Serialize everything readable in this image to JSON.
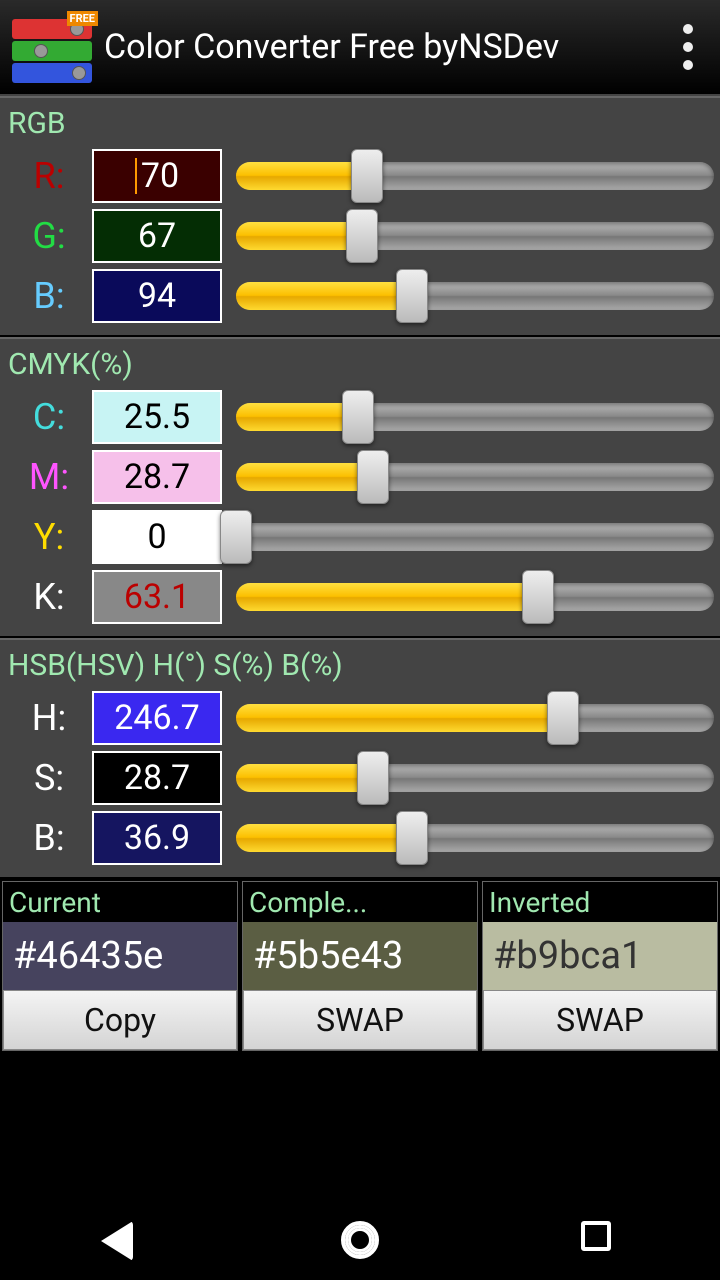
{
  "header": {
    "title": "Color Converter Free byNSDev",
    "free_badge": "FREE"
  },
  "rgb": {
    "label": "RGB",
    "rows": [
      {
        "ch": "R:",
        "val": "70",
        "pct": 27.5
      },
      {
        "ch": "G:",
        "val": "67",
        "pct": 26.3
      },
      {
        "ch": "B:",
        "val": "94",
        "pct": 36.9
      }
    ]
  },
  "cmyk": {
    "label": "CMYK(%)",
    "rows": [
      {
        "ch": "C:",
        "val": "25.5",
        "pct": 25.5
      },
      {
        "ch": "M:",
        "val": "28.7",
        "pct": 28.7
      },
      {
        "ch": "Y:",
        "val": "0",
        "pct": 0
      },
      {
        "ch": "K:",
        "val": "63.1",
        "pct": 63.1
      }
    ]
  },
  "hsb": {
    "label": "HSB(HSV) H(°) S(%) B(%)",
    "rows": [
      {
        "ch": "H:",
        "val": "246.7",
        "pct": 68.5
      },
      {
        "ch": "S:",
        "val": "28.7",
        "pct": 28.7
      },
      {
        "ch": "B:",
        "val": "36.9",
        "pct": 36.9
      }
    ]
  },
  "swatches": {
    "current": {
      "label": "Current",
      "hex": "#46435e",
      "btn": "Copy"
    },
    "comple": {
      "label": "Comple...",
      "hex": "#5b5e43",
      "btn": "SWAP"
    },
    "inverted": {
      "label": "Inverted",
      "hex": "#b9bca1",
      "btn": "SWAP"
    }
  }
}
